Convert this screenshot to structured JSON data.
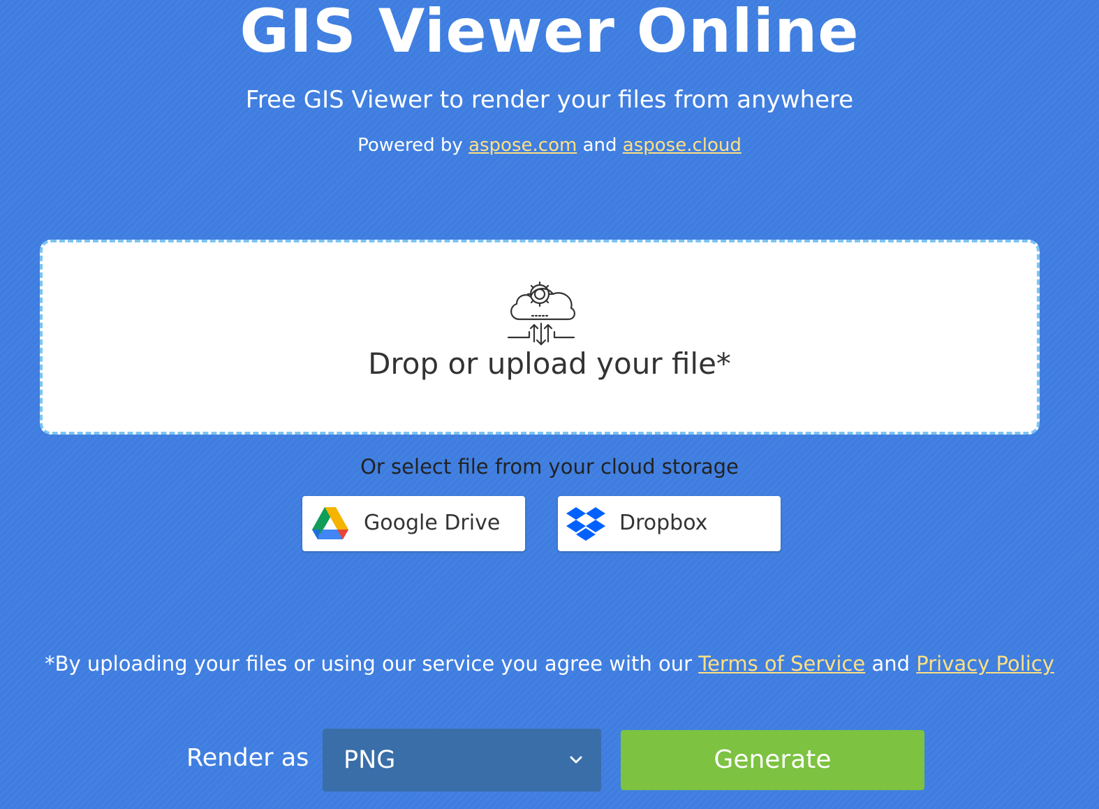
{
  "header": {
    "title": "GIS Viewer Online",
    "subtitle": "Free GIS Viewer to render your files from anywhere",
    "powered_prefix": "Powered by",
    "powered_link1": "aspose.com",
    "powered_and": "and",
    "powered_link2": "aspose.cloud"
  },
  "upload": {
    "icon": "cloud-gear-upload-icon",
    "drop_text": "Drop or upload your file*"
  },
  "cloud_storage": {
    "prompt": "Or select file from your cloud storage",
    "google_drive_label": "Google Drive",
    "dropbox_label": "Dropbox"
  },
  "notice": {
    "prefix": "*By uploading your files or using our service you agree with our",
    "terms_link": "Terms of Service",
    "and": "and",
    "privacy_link": "Privacy Policy"
  },
  "actions": {
    "render_label": "Render as",
    "render_format": "PNG",
    "generate_label": "Generate"
  },
  "colors": {
    "background": "#3f7ee0",
    "link": "#ffe082",
    "generate_button": "#7dc241",
    "select_bg": "#3a6ea9",
    "dropzone_border": "#7cc4f2"
  }
}
